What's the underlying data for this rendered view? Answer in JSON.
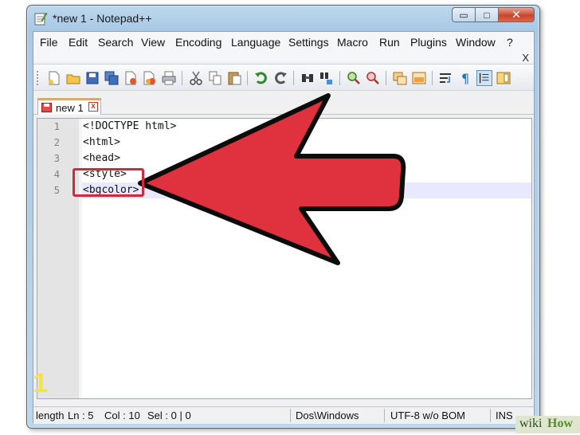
{
  "window": {
    "title": "*new  1 - Notepad++",
    "caption_buttons": {
      "minimize": "▭",
      "maximize": "□",
      "close": "✕"
    }
  },
  "menubar": {
    "items": [
      "File",
      "Edit",
      "Search",
      "View",
      "Encoding",
      "Language",
      "Settings",
      "Macro",
      "Run",
      "Plugins",
      "Window",
      "?"
    ],
    "close_label": "X"
  },
  "toolbar": {
    "icons": [
      "new-file-icon",
      "open-file-icon",
      "save-icon",
      "save-all-icon",
      "close-icon",
      "close-all-icon",
      "print-icon",
      "cut-icon",
      "copy-icon",
      "paste-icon",
      "undo-icon",
      "redo-icon",
      "find-icon",
      "replace-icon",
      "zoom-in-icon",
      "zoom-out-icon",
      "sync-vertical-icon",
      "sync-horizontal-icon",
      "word-wrap-icon",
      "show-all-chars-icon",
      "indent-guide-icon",
      "doc-map-icon"
    ]
  },
  "tabs": [
    {
      "label": "new  1",
      "close": "x",
      "modified": true
    }
  ],
  "editor": {
    "lines": [
      {
        "num": "1",
        "text": "<!DOCTYPE html>"
      },
      {
        "num": "2",
        "text": "<html>"
      },
      {
        "num": "3",
        "text": "<head>"
      },
      {
        "num": "4",
        "text": "<style>"
      },
      {
        "num": "5",
        "text": "<bgcolor>"
      }
    ],
    "current_line": 5
  },
  "statusbar": {
    "length": "length",
    "ln": "Ln : 5",
    "col": "Col : 10",
    "sel": "Sel : 0 | 0",
    "eol": "Dos\\Windows",
    "encoding": "UTF-8 w/o BOM",
    "mode": "INS"
  },
  "overlay": {
    "step_number": "1",
    "watermark_wiki": "wiki",
    "watermark_how": "How"
  },
  "colors": {
    "arrow": "#e0313f",
    "highlight": "#d6283a",
    "tab_accent": "#f7a43a",
    "current_line": "#e8e8ff"
  }
}
